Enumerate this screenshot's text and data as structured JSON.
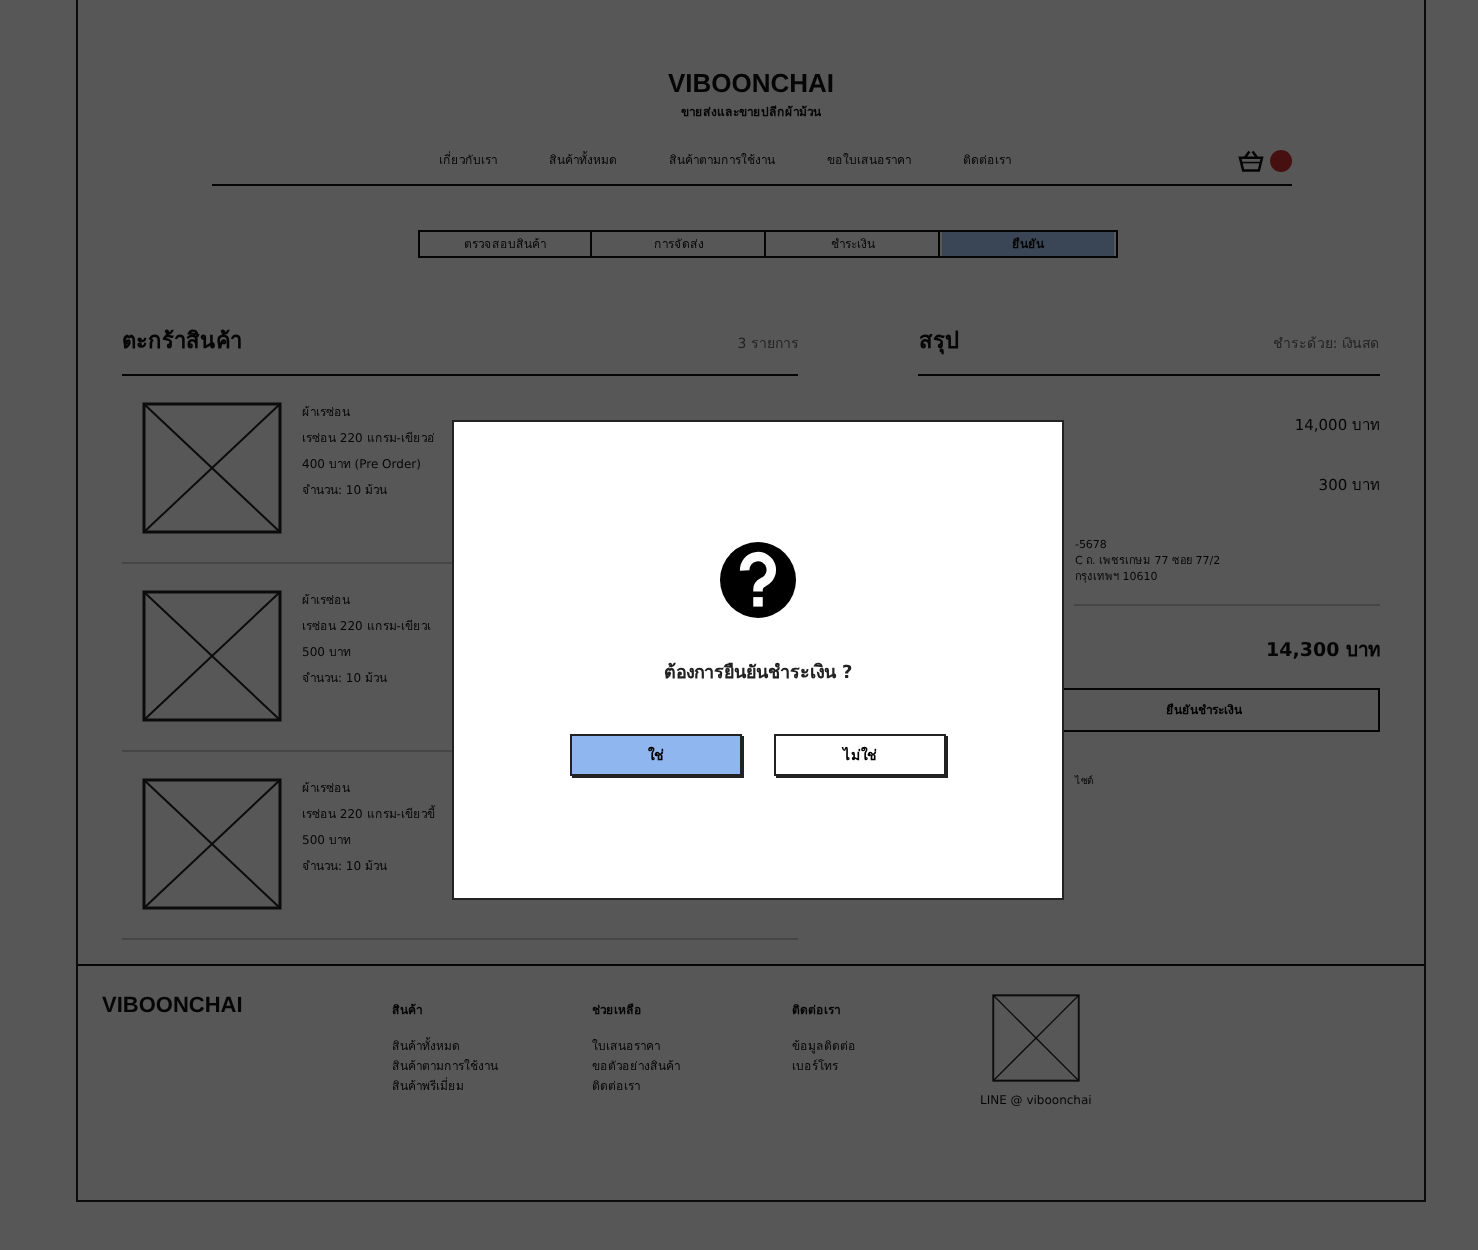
{
  "header": {
    "brand": "VIBOONCHAI",
    "tagline": "ขายส่งและขายปลีกผ้าม้วน",
    "nav": [
      "เกี่ยวกับเรา",
      "สินค้าทั้งหมด",
      "สินค้าตามการใช้งาน",
      "ขอใบเสนอราคา",
      "ติดต่อเรา"
    ]
  },
  "steps": [
    {
      "label": "ตรวจสอบสินค้า",
      "selected": false
    },
    {
      "label": "การจัดส่ง",
      "selected": false
    },
    {
      "label": "ชำระเงิน",
      "selected": false
    },
    {
      "label": "ยืนยัน",
      "selected": true
    }
  ],
  "cart": {
    "title": "ตะกร้าสินค้า",
    "count": "3 รายการ",
    "items": [
      {
        "lines": [
          "ผ้าเรซ่อน",
          "เรซ่อน 220 แกรม-เขียวอ่",
          "400 บาท  (Pre Order)",
          "จำนวน: 10 ม้วน"
        ]
      },
      {
        "lines": [
          "ผ้าเรซ่อน",
          "เรซ่อน 220 แกรม-เขียวเ",
          "500 บาท",
          "จำนวน: 10 ม้วน"
        ]
      },
      {
        "lines": [
          "ผ้าเรซ่อน",
          "เรซ่อน 220 แกรม-เขียวขี้",
          "500 บาท",
          "จำนวน: 10 ม้วน"
        ]
      }
    ]
  },
  "summary": {
    "title": "สรุป",
    "payment": "ชำระด้วย: เงินสด",
    "subtotal": "14,000 บาท",
    "shipping": "300 บาท",
    "address": [
      "-5678",
      "C ถ. เพชรเกษม 77 ซอย 77/2",
      "กรุงเทพฯ 10610"
    ],
    "total": "14,300 บาท",
    "confirm": "ยืนยันชำระเงิน",
    "note": "ไซต์"
  },
  "footer": {
    "brand": "VIBOONCHAI",
    "columns": [
      {
        "title": "สินค้า",
        "links": [
          "สินค้าทั้งหมด",
          "สินค้าตามการใช้งาน",
          "สินค้าพรีเมี่ยม"
        ]
      },
      {
        "title": "ช่วยเหลือ",
        "links": [
          "ใบเสนอราคา",
          "ขอตัวอย่างสินค้า",
          "ติดต่อเรา"
        ]
      },
      {
        "title": "ติดต่อเรา",
        "links": [
          "ข้อมูลติดต่อ",
          "เบอร์โทร"
        ]
      }
    ],
    "line": "LINE @ viboonchai"
  },
  "dialog": {
    "message": "ต้องการยืนยันชำระเงิน ?",
    "buttons": [
      {
        "label": "ใช่",
        "selected": true
      },
      {
        "label": "ไม่ใช่",
        "selected": false
      }
    ]
  }
}
